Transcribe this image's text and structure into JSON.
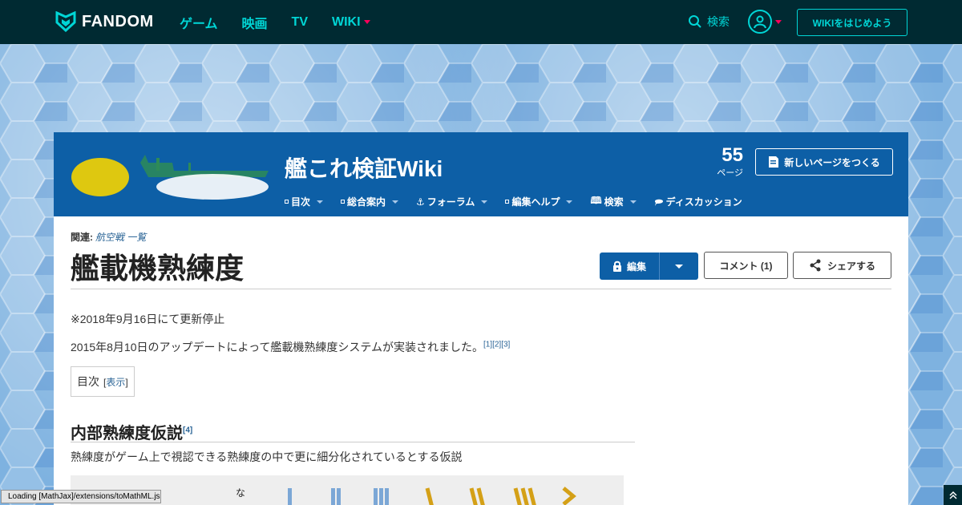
{
  "topnav": {
    "brand": "FANDOM",
    "links": [
      "ゲーム",
      "映画",
      "TV",
      "WIKI"
    ],
    "search_label": "検索",
    "start_wiki": "WIKIをはじめよう"
  },
  "community": {
    "title": "艦これ検証Wiki",
    "page_count": "55",
    "page_label": "ページ",
    "new_page": "新しいページをつくる",
    "nav": [
      "目次",
      "総合案内",
      "フォーラム",
      "編集ヘルプ",
      "検索",
      "ディスカッション"
    ]
  },
  "article": {
    "related_label": "関連:",
    "related_links": "航空戦  一覧",
    "title": "艦載機熟練度",
    "edit": "編集",
    "comment": "コメント (1)",
    "share": "シェアする",
    "p1": "※2018年9月16日にて更新停止",
    "p2": "2015年8月10日のアップデートによって艦載機熟練度システムが実装されました。",
    "p2_refs": "[1][2][3]",
    "toc_label": "目次",
    "toc_show_open": "[",
    "toc_show": "表示",
    "toc_show_close": "]",
    "h2": "内部熟練度仮説",
    "h2_ref": "[4]",
    "p3": "熟練度がゲーム上で視認できる熟練度の中で更に細分化されているとする仮説",
    "table_cell": "な"
  },
  "status": {
    "loading": "Loading [MathJax]/extensions/toMathML.js"
  },
  "colors": {
    "topnav_bg": "#002a32",
    "accent": "#00d6d6",
    "community_bg": "#0d5fa6",
    "caret": "#fa005a"
  }
}
